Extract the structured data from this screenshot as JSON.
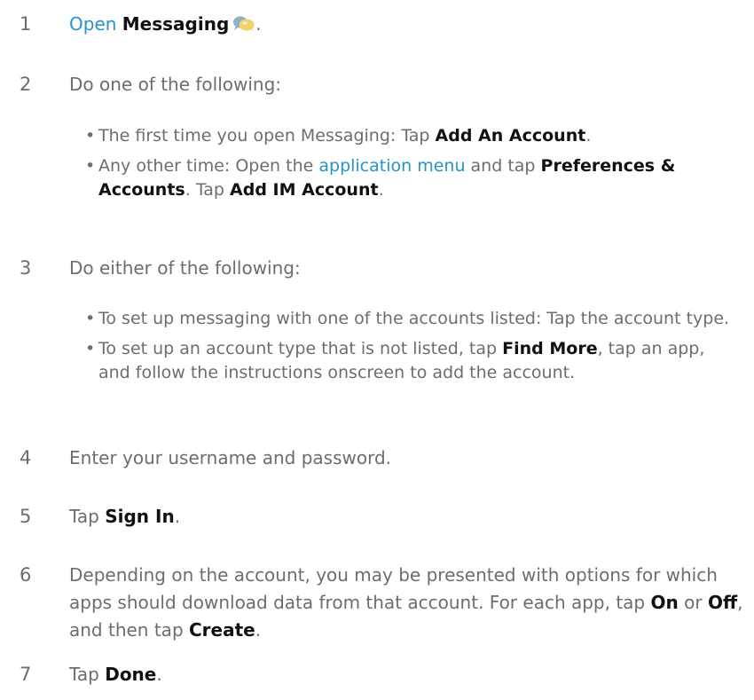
{
  "steps": [
    {
      "number": "1",
      "link": "Open",
      "bold": "Messaging",
      "end": "."
    },
    {
      "number": "2",
      "text": "Do one of the following:",
      "bullets": [
        {
          "a": "The first time you open Messaging: Tap ",
          "b": "Add An Account",
          "c": "."
        },
        {
          "a": "Any other time: Open the ",
          "link": "application menu",
          "c": " and tap ",
          "b": "Preferences & Accounts",
          "d": ". Tap ",
          "b2": "Add IM Account",
          "e": "."
        }
      ]
    },
    {
      "number": "3",
      "text": "Do either of the following:",
      "bullets": [
        {
          "a": "To set up messaging with one of the accounts listed: Tap the account type."
        },
        {
          "a": "To set up an account type that is not listed, tap ",
          "b": "Find More",
          "c": ", tap an app, and follow the instructions onscreen to add the account."
        }
      ]
    },
    {
      "number": "4",
      "text": "Enter your username and password."
    },
    {
      "number": "5",
      "a": "Tap ",
      "b": "Sign In",
      "c": "."
    },
    {
      "number": "6",
      "a": "Depending on the account, you may be presented with options for which apps should download data from that account. For each app, tap ",
      "b1": "On",
      "mid": " or ",
      "b2": "Off",
      "c": ", and then tap ",
      "b3": "Create",
      "d": "."
    },
    {
      "number": "7",
      "a": "Tap ",
      "b": "Done",
      "c": "."
    }
  ],
  "icons": {
    "messaging": "messaging-chat-bubbles-icon"
  },
  "colors": {
    "body_text": "#6d6d6d",
    "bold_text": "#111111",
    "link": "#2793c7"
  }
}
